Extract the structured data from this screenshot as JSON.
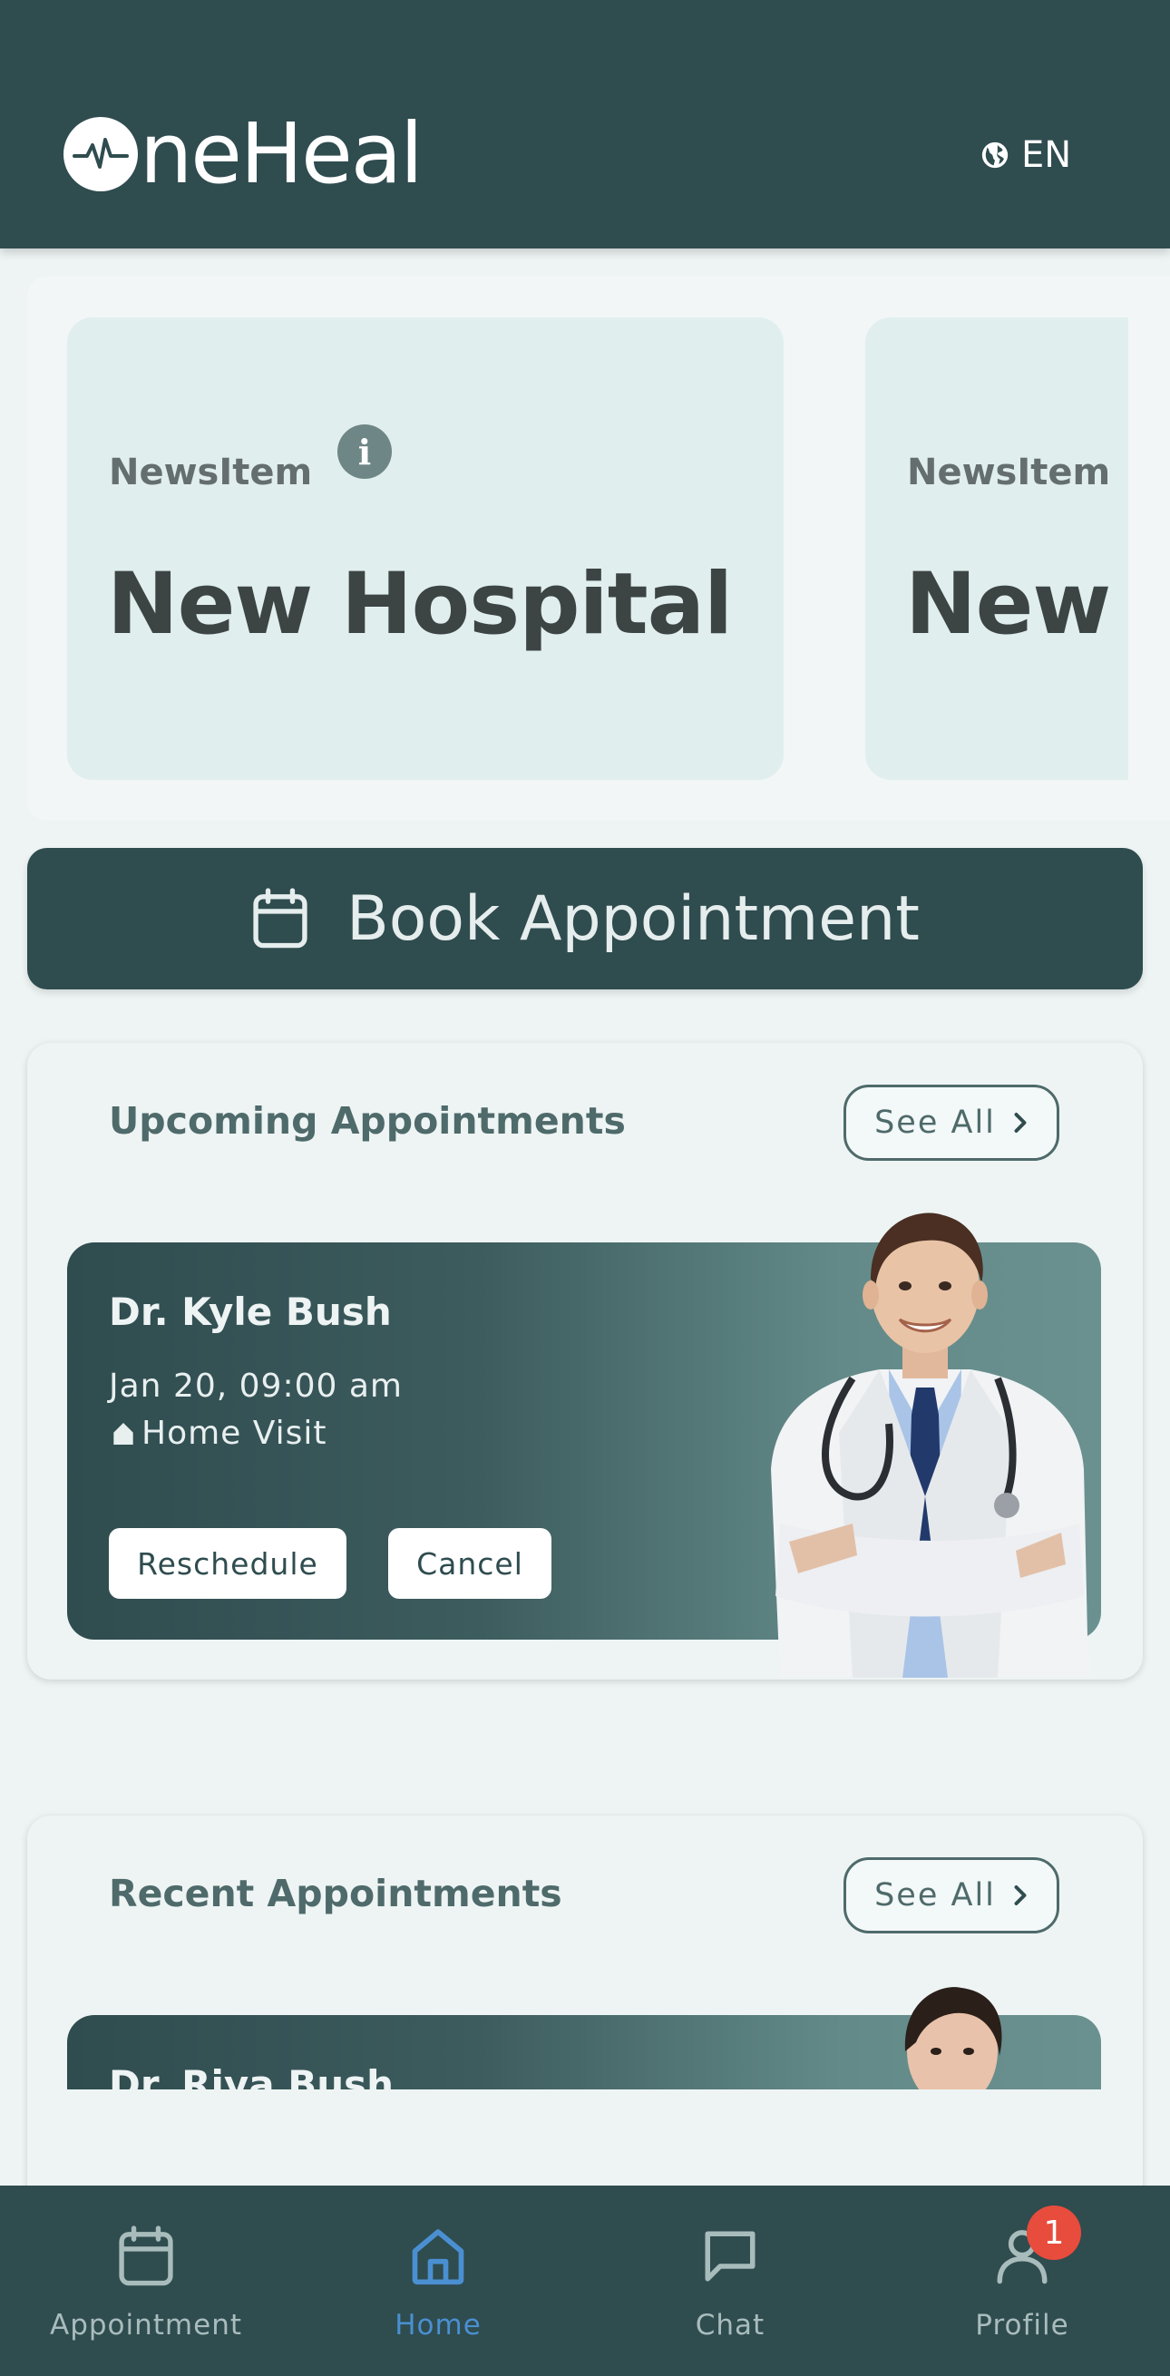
{
  "header": {
    "logo_text": "neHeal",
    "language": "EN"
  },
  "news": [
    {
      "label": "NewsItem",
      "title": "New Hospital"
    },
    {
      "label": "NewsItem",
      "title": "New Hospital"
    }
  ],
  "book_button": {
    "label": "Book Appointment"
  },
  "upcoming": {
    "title": "Upcoming Appointments",
    "see_all": "See All",
    "appointment": {
      "doctor": "Dr. Kyle Bush",
      "datetime": "Jan 20, 09:00 am",
      "type": "Home Visit",
      "reschedule": "Reschedule",
      "cancel": "Cancel"
    }
  },
  "recent": {
    "title": "Recent Appointments",
    "see_all": "See All",
    "appointment": {
      "doctor": "Dr. Riya Bush"
    }
  },
  "nav": {
    "items": [
      {
        "label": "Appointment",
        "icon": "calendar-icon"
      },
      {
        "label": "Home",
        "icon": "home-icon"
      },
      {
        "label": "Chat",
        "icon": "chat-icon"
      },
      {
        "label": "Profile",
        "icon": "user-icon"
      }
    ],
    "active": "Home",
    "profile_badge": "1"
  },
  "colors": {
    "primary": "#2f4c4f",
    "background": "#eef4f4",
    "active_nav": "#4a8fd1",
    "badge": "#e74c3c"
  }
}
